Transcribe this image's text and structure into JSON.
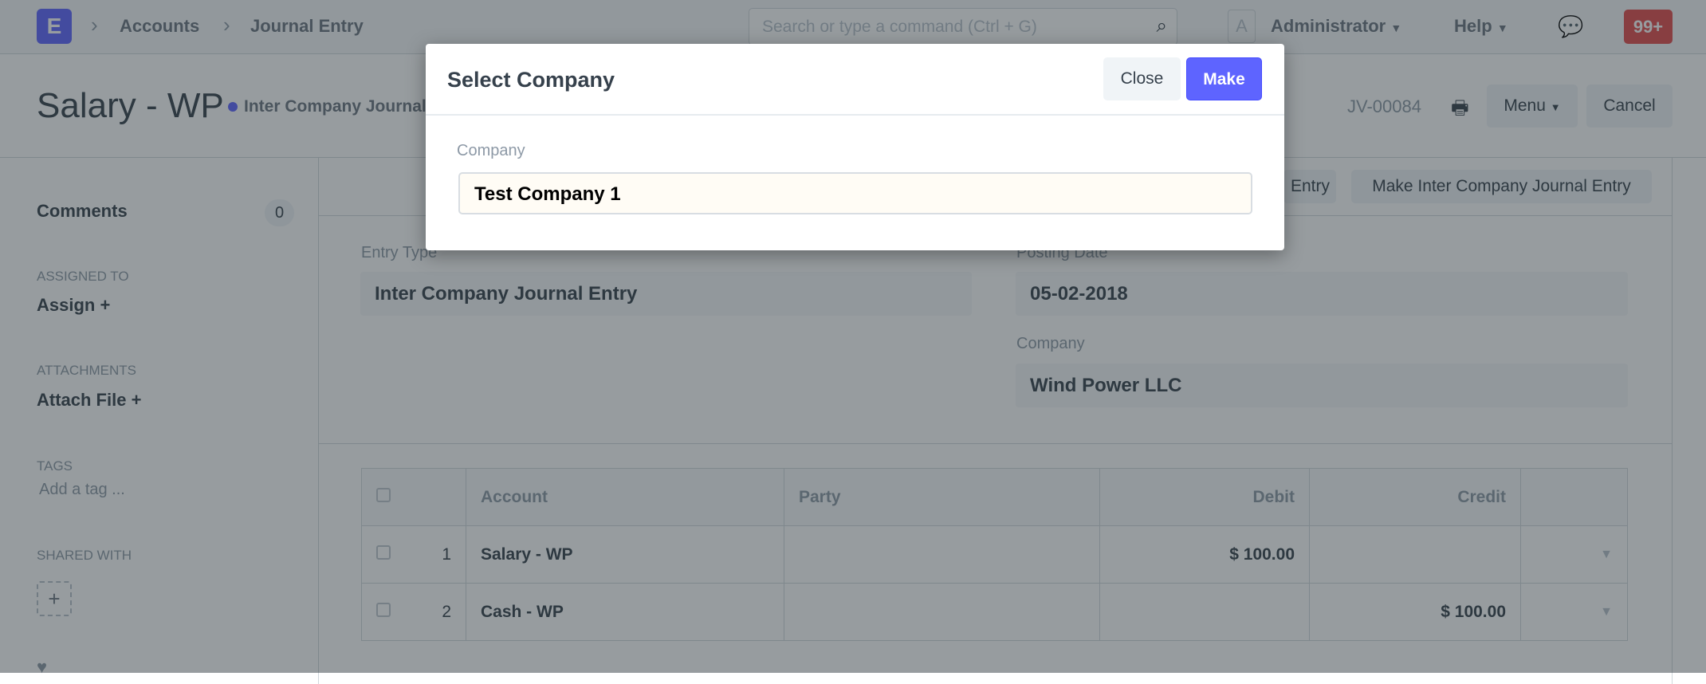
{
  "navbar": {
    "logo": "E",
    "breadcrumbs": [
      "Accounts",
      "Journal Entry"
    ],
    "search_placeholder": "Search or type a command (Ctrl + G)",
    "avatar": "A",
    "user": "Administrator",
    "help": "Help",
    "notifications": "99+"
  },
  "page": {
    "title": "Salary - WP",
    "status": "Inter Company Journal Entry",
    "doc_id": "JV-00084",
    "menu": "Menu",
    "cancel": "Cancel"
  },
  "sidebar": {
    "comments": "Comments",
    "comments_count": "0",
    "assigned_to": "Assigned To",
    "assign": "Assign +",
    "attachments": "Attachments",
    "attach_file": "Attach File +",
    "tags": "Tags",
    "add_tag": "Add a tag ...",
    "shared_with": "Shared With",
    "add_share": "+"
  },
  "toolbar": {
    "button1": "Entry",
    "button2": "Make Inter Company Journal Entry"
  },
  "form": {
    "entry_type_label": "Entry Type",
    "entry_type": "Inter Company Journal Entry",
    "posting_date_label": "Posting Date",
    "posting_date": "05-02-2018",
    "company_label": "Company",
    "company": "Wind Power LLC"
  },
  "table": {
    "headers": [
      "Account",
      "Party",
      "Debit",
      "Credit"
    ],
    "rows": [
      {
        "no": "1",
        "account": "Salary - WP",
        "party": "",
        "debit": "$ 100.00",
        "credit": ""
      },
      {
        "no": "2",
        "account": "Cash - WP",
        "party": "",
        "debit": "",
        "credit": "$ 100.00"
      }
    ]
  },
  "modal": {
    "title": "Select Company",
    "close": "Close",
    "make": "Make",
    "company_label": "Company",
    "company_value": "Test Company 1"
  },
  "colors": {
    "primary": "#5e64ff",
    "badge": "#e24c4c"
  }
}
